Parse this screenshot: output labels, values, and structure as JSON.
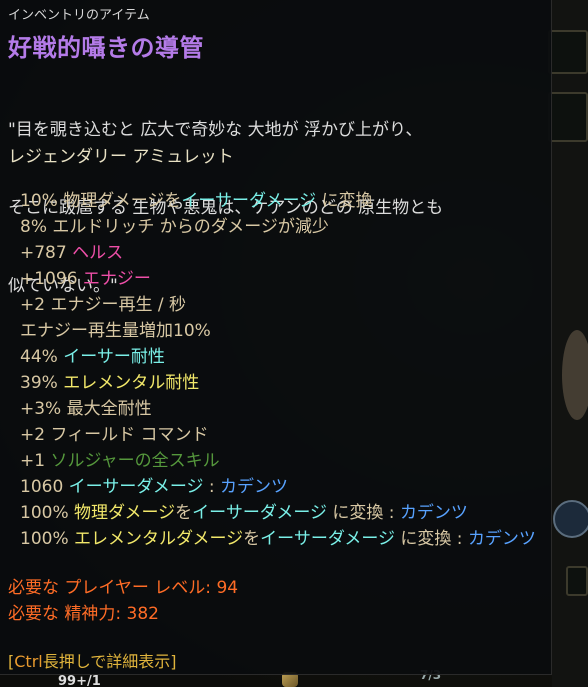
{
  "header": "インベントリのアイテム",
  "item": {
    "name": "好戦的囁きの導管",
    "flavor_lines": [
      "\"目を覗き込むと 広大で奇妙な 大地が 浮かび上がり、",
      "そこに跋扈する 生物や悪鬼は、ケアンのどの 原生物とも",
      "似ていない。\""
    ],
    "type": "レジェンダリー アミュレット"
  },
  "stats": [
    [
      {
        "t": "10% ",
        "c": "tan"
      },
      {
        "t": "物理ダメージ",
        "c": "tan"
      },
      {
        "t": "を",
        "c": "tan"
      },
      {
        "t": "イーサーダメージ",
        "c": "cyan"
      },
      {
        "t": " に変換",
        "c": "tan"
      }
    ],
    [
      {
        "t": "8% エルドリッチ からのダメージが減少",
        "c": "tan"
      }
    ],
    [
      {
        "t": "+787 ",
        "c": "tan"
      },
      {
        "t": "ヘルス",
        "c": "pink"
      }
    ],
    [
      {
        "t": "+1096 ",
        "c": "tan"
      },
      {
        "t": "エナジー",
        "c": "pink"
      }
    ],
    [
      {
        "t": "+2 エナジー再生 / 秒",
        "c": "tan"
      }
    ],
    [
      {
        "t": "エナジー再生量増加10%",
        "c": "tan"
      }
    ],
    [
      {
        "t": "44% ",
        "c": "tan"
      },
      {
        "t": "イーサー耐性",
        "c": "cyan"
      }
    ],
    [
      {
        "t": "39% ",
        "c": "tan"
      },
      {
        "t": "エレメンタル耐性",
        "c": "gold"
      }
    ],
    [
      {
        "t": "+3% 最大全耐性",
        "c": "tan"
      }
    ],
    [
      {
        "t": "+2  フィールド コマンド",
        "c": "tan"
      }
    ],
    [
      {
        "t": "+1 ",
        "c": "tan"
      },
      {
        "t": "ソルジャーの全スキル",
        "c": "green"
      }
    ],
    [
      {
        "t": "1060 ",
        "c": "tan"
      },
      {
        "t": "イーサーダメージ",
        "c": "cyan"
      },
      {
        "t": " : ",
        "c": "tan"
      },
      {
        "t": "カデンツ",
        "c": "blue"
      }
    ],
    [
      {
        "t": "100% ",
        "c": "tan"
      },
      {
        "t": "物理ダメージ",
        "c": "gold"
      },
      {
        "t": "を",
        "c": "tan"
      },
      {
        "t": "イーサーダメージ",
        "c": "cyan"
      },
      {
        "t": " に変換 : ",
        "c": "tan"
      },
      {
        "t": "カデンツ",
        "c": "blue"
      }
    ],
    [
      {
        "t": "100% ",
        "c": "tan"
      },
      {
        "t": "エレメンタルダメージ",
        "c": "gold"
      },
      {
        "t": "を",
        "c": "tan"
      },
      {
        "t": "イーサーダメージ",
        "c": "cyan"
      },
      {
        "t": " に変換 : ",
        "c": "tan"
      },
      {
        "t": "カデンツ",
        "c": "blue"
      }
    ]
  ],
  "requirements": {
    "level_label": "必要な プレイヤー レベル: ",
    "level_value": "94",
    "spirit_label": "必要な 精神力: ",
    "spirit_value": "382"
  },
  "hint": {
    "bracket_open": "[",
    "key": "Ctrl",
    "text": "長押しで詳細表示]"
  },
  "background": {
    "stack_text": "99+/1",
    "slot_text": "7/3"
  },
  "colors": {
    "name": "#b47be8",
    "tan": "#d8c8a4",
    "cyan": "#7af0e8",
    "pink": "#ee4fa8",
    "gold": "#f2e86a",
    "green": "#55983c",
    "blue": "#58a2ff",
    "requirement": "#ff6c26",
    "hint": "#e0b43c"
  }
}
